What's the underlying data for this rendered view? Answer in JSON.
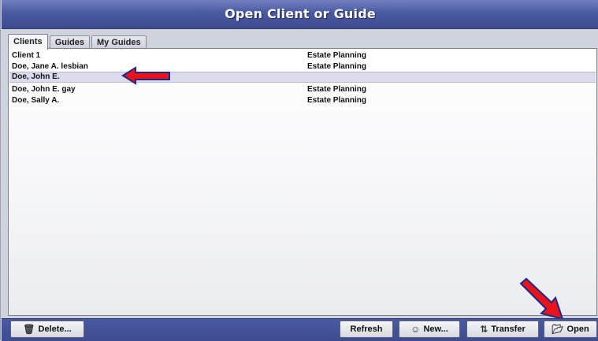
{
  "window": {
    "title": "Open Client or Guide"
  },
  "tabs": [
    {
      "label": "Clients",
      "active": true
    },
    {
      "label": "Guides",
      "active": false
    },
    {
      "label": "My Guides",
      "active": false
    }
  ],
  "list": {
    "rows": [
      {
        "name": "Client 1",
        "type": "Estate Planning",
        "selected": false
      },
      {
        "name": "Doe, Jane A. lesbian",
        "type": "Estate Planning",
        "selected": false
      },
      {
        "name": "Doe, John E.",
        "type": "",
        "selected": true
      },
      {
        "name": "Doe, John E. gay",
        "type": "Estate Planning",
        "selected": false
      },
      {
        "name": "Doe, Sally A.",
        "type": "Estate Planning",
        "selected": false
      }
    ]
  },
  "annotations": {
    "arrow_color": "#e8141c",
    "arrow_outline": "#1a2a8a"
  },
  "buttons": {
    "delete": {
      "label": "Delete...",
      "icon": "trash-icon"
    },
    "refresh": {
      "label": "Refresh"
    },
    "new": {
      "label": "New...",
      "icon": "add-user-icon"
    },
    "transfer": {
      "label": "Transfer",
      "icon": "transfer-icon"
    },
    "open": {
      "label": "Open",
      "icon": "open-folder-icon"
    }
  }
}
